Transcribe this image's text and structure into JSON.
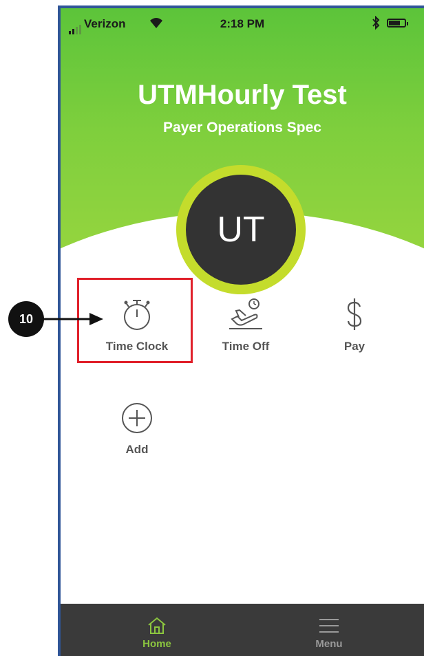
{
  "status_bar": {
    "carrier": "Verizon",
    "time": "2:18 PM"
  },
  "header": {
    "title": "UTMHourly Test",
    "subtitle": "Payer Operations Spec"
  },
  "avatar": {
    "initials": "UT"
  },
  "tiles": [
    {
      "label": "Time Clock",
      "icon": "stopwatch-icon"
    },
    {
      "label": "Time Off",
      "icon": "plane-icon"
    },
    {
      "label": "Pay",
      "icon": "dollar-icon"
    },
    {
      "label": "Add",
      "icon": "plus-circle-icon"
    }
  ],
  "tab_bar": {
    "items": [
      {
        "label": "Home",
        "icon": "home-icon",
        "active": true
      },
      {
        "label": "Menu",
        "icon": "menu-icon",
        "active": false
      }
    ]
  },
  "annotation": {
    "step_number": "10"
  },
  "colors": {
    "brand_green": "#7fcf3d",
    "avatar_ring": "#c4dc2c",
    "avatar_fill": "#333333",
    "tab_bar_bg": "#3a3a3a",
    "tab_active": "#8cc63f",
    "tab_inactive": "#9a9a9a",
    "highlight": "#e0202a"
  }
}
